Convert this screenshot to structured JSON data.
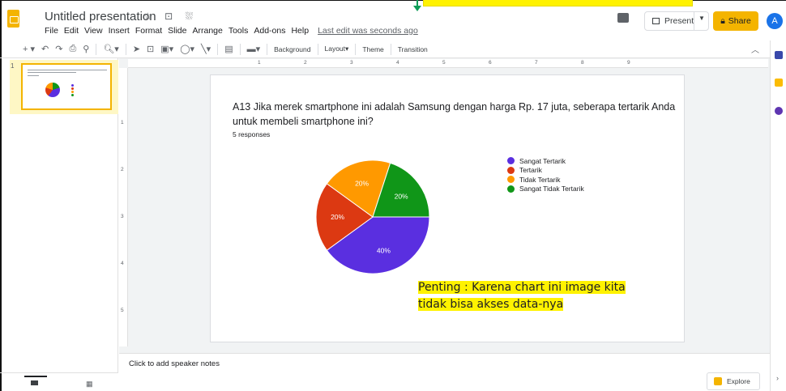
{
  "header": {
    "doc_title": "Untitled presentation",
    "title_icons": "☆ ⊡ ⛆",
    "menu": [
      "File",
      "Edit",
      "View",
      "Insert",
      "Format",
      "Slide",
      "Arrange",
      "Tools",
      "Add-ons",
      "Help"
    ],
    "last_edit": "Last edit was seconds ago",
    "present_label": "Present",
    "share_label": "Share",
    "avatar_letter": "A"
  },
  "toolbar": {
    "background_label": "Background",
    "layout_label": "Layout",
    "theme_label": "Theme",
    "transition_label": "Transition"
  },
  "rulers": {
    "top_ticks": [
      "1",
      "2",
      "3",
      "4",
      "5",
      "6",
      "7",
      "8",
      "9"
    ],
    "left_ticks": [
      "1",
      "2",
      "3",
      "4",
      "5"
    ]
  },
  "filmstrip": {
    "slide_number": "1"
  },
  "slide": {
    "question": "A13 Jika merek smartphone ini adalah Samsung dengan harga Rp. 17 juta, seberapa tertarik Anda untuk membeli smartphone ini?",
    "responses": "5 responses",
    "note_line1": "Penting : Karena chart ini image kita",
    "note_line2": "tidak bisa akses data-nya"
  },
  "chart_data": {
    "type": "pie",
    "title": "",
    "categories": [
      "Sangat Tertarik",
      "Tertarik",
      "Tidak Tertarik",
      "Sangat Tidak Tertarik"
    ],
    "values": [
      40,
      20,
      20,
      20
    ],
    "labels": [
      "40%",
      "20%",
      "20%",
      "20%"
    ],
    "colors": [
      "#5a2fe0",
      "#dc3912",
      "#ff9900",
      "#109618"
    ],
    "legend_position": "right"
  },
  "notes": {
    "speaker_notes_placeholder": "Click to add speaker notes",
    "explore_label": "Explore"
  },
  "colors": {
    "accent": "#f4b400",
    "highlight": "#fff200",
    "avatar": "#1a73e8"
  }
}
